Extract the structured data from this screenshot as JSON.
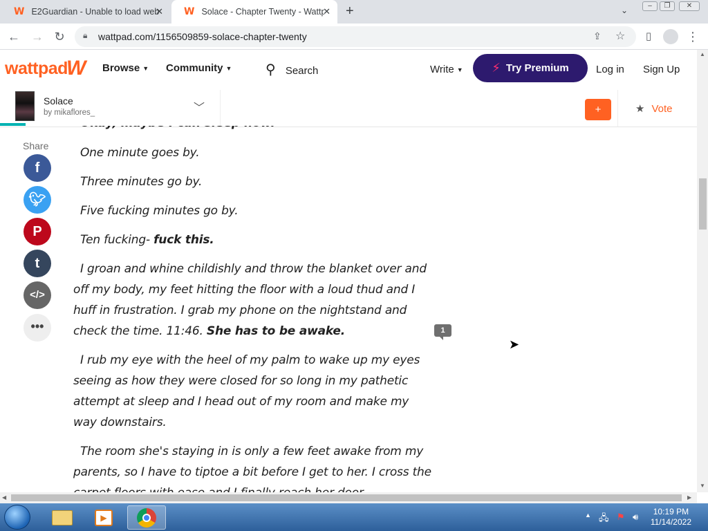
{
  "browser": {
    "tabs": [
      {
        "title": "E2Guardian - Unable to load web",
        "active": false
      },
      {
        "title": "Solace - Chapter Twenty - Wattp",
        "active": true
      }
    ],
    "new_tab_symbol": "+",
    "url": "wattpad.com/1156509859-solace-chapter-twenty"
  },
  "header": {
    "logo": "wattpad",
    "nav": {
      "browse": "Browse",
      "community": "Community",
      "search": "Search",
      "write": "Write"
    },
    "premium": "Try Premium",
    "login": "Log in",
    "signup": "Sign Up"
  },
  "storybar": {
    "title": "Solace",
    "author": "by mikaflores_",
    "add_symbol": "+",
    "vote": "Vote",
    "read_progress": 0.036
  },
  "share": {
    "label": "Share"
  },
  "story": {
    "cut_line": "Okay, maybe I can sleep now.",
    "p1": "One minute goes by.",
    "p2": "Three minutes go by.",
    "p3": "Five fucking minutes go by.",
    "p4a": "Ten fucking- ",
    "p4b": "fuck this.",
    "p5a": "I groan and whine childishly and throw the blanket over and off my body, my feet hitting the floor with a loud thud and I huff in frustration. I grab my phone on the nightstand and check the time. 11:46. ",
    "p5b": "She has to be awake.",
    "p6": "I rub my eye with the heel of my palm to wake up my eyes seeing as how they were closed for so long in my pathetic attempt at sleep and I head out of my room and make my way downstairs.",
    "p7": "The room she's staying in is only a few feet awake from my parents, so I have to tiptoe a bit before I get to her. I cross the carpet floors with ease and I finally reach her door.",
    "comment_count": "1"
  },
  "taskbar": {
    "time": "10:19 PM",
    "date": "11/14/2022"
  },
  "colors": {
    "brand": "#ff6122",
    "premium": "#2d1a6e",
    "progress": "#00b2b2"
  }
}
